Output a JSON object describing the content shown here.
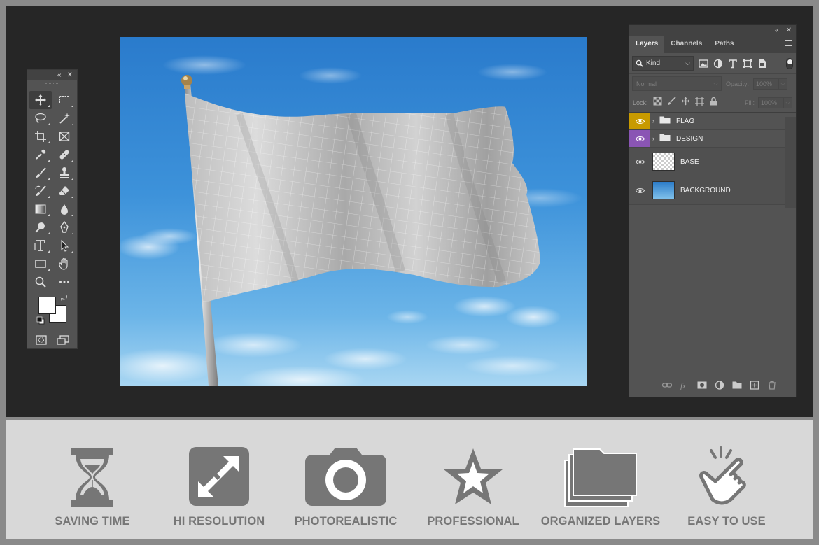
{
  "workspace": {
    "colors": {
      "background": "#262626",
      "panel": "#535353",
      "band": "#d8d8d8",
      "feature_gray": "#767676"
    }
  },
  "canvas": {
    "image": "waving blank flag mockup on flagpole against blue sky"
  },
  "toolbox": {
    "header_icons": [
      "collapse-icon",
      "close-icon"
    ],
    "tools": [
      "move-tool-icon",
      "marquee-tool-icon",
      "lasso-tool-icon",
      "magic-wand-tool-icon",
      "crop-tool-icon",
      "frame-tool-icon",
      "eyedropper-tool-icon",
      "healing-brush-tool-icon",
      "brush-tool-icon",
      "clone-stamp-tool-icon",
      "history-brush-tool-icon",
      "eraser-tool-icon",
      "gradient-tool-icon",
      "blur-tool-icon",
      "dodge-tool-icon",
      "pen-tool-icon",
      "type-tool-icon",
      "path-selection-tool-icon",
      "rectangle-tool-icon",
      "hand-tool-icon",
      "zoom-tool-icon",
      "more-tools-icon"
    ],
    "foreground_color": "#ffffff",
    "background_color": "#ffffff"
  },
  "layers_panel": {
    "tabs": [
      {
        "label": "Layers",
        "active": true
      },
      {
        "label": "Channels",
        "active": false
      },
      {
        "label": "Paths",
        "active": false
      }
    ],
    "filter": {
      "kind_label": "Kind"
    },
    "blend": {
      "mode": "Normal",
      "opacity_label": "Opacity:",
      "opacity_value": "100%"
    },
    "lock": {
      "label": "Lock:",
      "fill_label": "Fill:",
      "fill_value": "100%"
    },
    "layers": [
      {
        "name": "FLAG",
        "type": "group",
        "color": "#c89a00"
      },
      {
        "name": "DESIGN",
        "type": "group",
        "color": "#8a55b4"
      },
      {
        "name": "BASE",
        "type": "layer",
        "thumbnail": "transparent"
      },
      {
        "name": "BACKGROUND",
        "type": "layer",
        "thumbnail": "sky"
      }
    ],
    "footer_icons": [
      "link-layers-icon",
      "fx-icon",
      "add-mask-icon",
      "adjustment-layer-icon",
      "new-group-icon",
      "new-layer-icon",
      "delete-layer-icon"
    ]
  },
  "features": [
    {
      "label": "SAVING TIME",
      "icon": "hourglass-icon"
    },
    {
      "label": "HI RESOLUTION",
      "icon": "expand-arrows-icon"
    },
    {
      "label": "PHOTOREALISTIC",
      "icon": "camera-icon"
    },
    {
      "label": "PROFESSIONAL",
      "icon": "star-icon"
    },
    {
      "label": "ORGANIZED LAYERS",
      "icon": "folders-icon"
    },
    {
      "label": "EASY TO USE",
      "icon": "tap-hand-icon"
    }
  ]
}
